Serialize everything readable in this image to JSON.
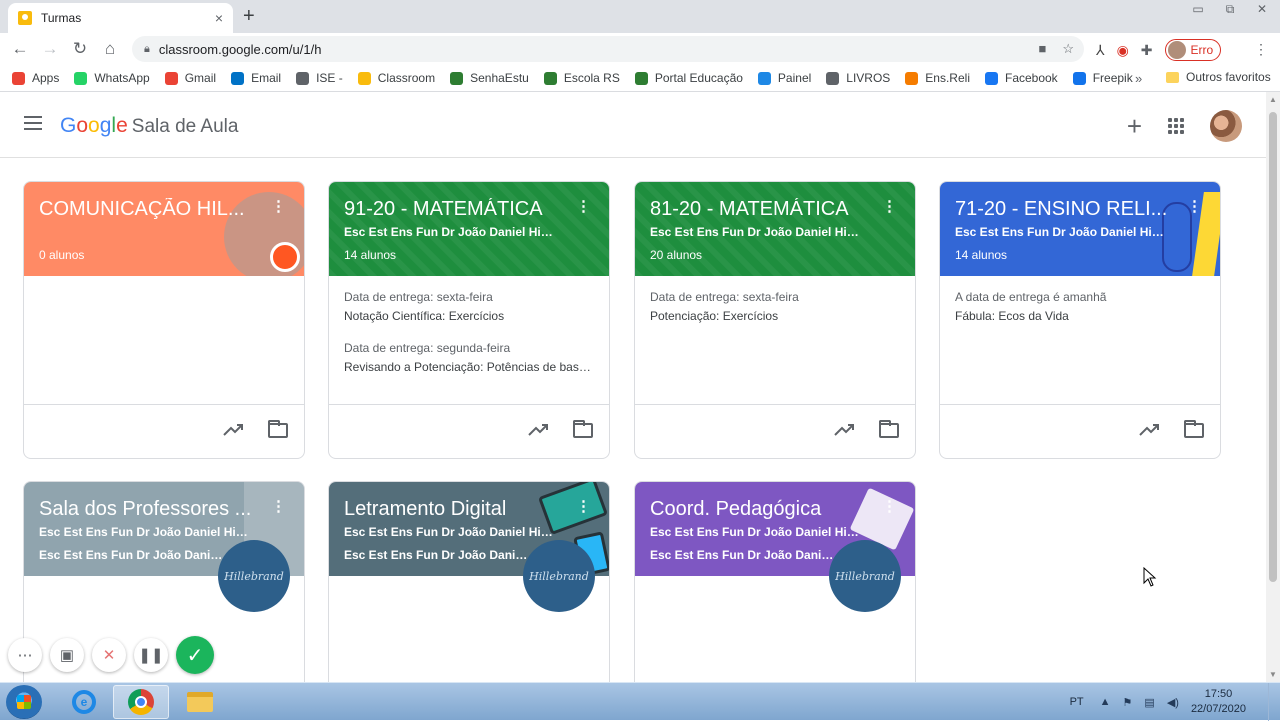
{
  "browser": {
    "tab_title": "Turmas",
    "tab_close": "×",
    "new_tab": "+",
    "url": "classroom.google.com/u/1/h",
    "profile_label": "Erro",
    "bookmarks": [
      {
        "label": "Apps",
        "icon": "apps-grid-icon",
        "color": "#ea4335"
      },
      {
        "label": "WhatsApp",
        "icon": "whatsapp-icon",
        "color": "#25d366"
      },
      {
        "label": "Gmail",
        "icon": "gmail-icon",
        "color": "#ea4335"
      },
      {
        "label": "Email",
        "icon": "outlook-icon",
        "color": "#0072c6"
      },
      {
        "label": "ISE -",
        "icon": "globe-icon",
        "color": "#5f6368"
      },
      {
        "label": "Classroom",
        "icon": "classroom-icon",
        "color": "#f9bb0d"
      },
      {
        "label": "SenhaEstu",
        "icon": "shield-icon",
        "color": "#2e7d32"
      },
      {
        "label": "Escola RS",
        "icon": "shield-icon",
        "color": "#2e7d32"
      },
      {
        "label": "Portal Educação",
        "icon": "shield-icon",
        "color": "#2e7d32"
      },
      {
        "label": "Painel",
        "icon": "share-icon",
        "color": "#1e88e5"
      },
      {
        "label": "LIVROS",
        "icon": "globe-icon",
        "color": "#5f6368"
      },
      {
        "label": "Ens.Reli",
        "icon": "blogger-icon",
        "color": "#f57c00"
      },
      {
        "label": "Facebook",
        "icon": "facebook-icon",
        "color": "#1877f2"
      },
      {
        "label": "Freepik",
        "icon": "freepik-icon",
        "color": "#1273eb"
      }
    ],
    "more_bookmarks": "»",
    "other_bookmarks": "Outros favoritos"
  },
  "app": {
    "logo_text": [
      "G",
      "o",
      "o",
      "g",
      "l",
      "e"
    ],
    "product_name": "Sala de Aula"
  },
  "cards": [
    {
      "title": "COMUNICAÇÃO HIL...",
      "section": "",
      "subsection": "",
      "count": "0 alunos",
      "color": "#ff8a65",
      "tasks": []
    },
    {
      "title": "91-20 - MATEMÁTICA",
      "section": "Esc Est Ens Fun Dr João Daniel Hilleb...",
      "subsection": "",
      "count": "14 alunos",
      "color": "#1e8e3e",
      "tasks": [
        {
          "due": "Data de entrega: sexta-feira",
          "name": "Notação Científica: Exercícios"
        },
        {
          "due": "Data de entrega: segunda-feira",
          "name": "Revisando a Potenciação: Potências de base..."
        }
      ]
    },
    {
      "title": "81-20 - MATEMÁTICA",
      "section": "Esc Est Ens Fun Dr João Daniel Hilleb...",
      "subsection": "",
      "count": "20 alunos",
      "color": "#1e8e3e",
      "tasks": [
        {
          "due": "Data de entrega: sexta-feira",
          "name": "Potenciação: Exercícios"
        }
      ]
    },
    {
      "title": "71-20 - ENSINO RELI...",
      "section": "Esc Est Ens Fun Dr João Daniel Hilleb...",
      "subsection": "",
      "count": "14 alunos",
      "color": "#3367d6",
      "tasks": [
        {
          "due": "A data de entrega é amanhã",
          "name": "Fábula: Ecos da Vida"
        }
      ]
    },
    {
      "title": "Sala dos Professores ...",
      "section": "Esc Est Ens Fun Dr João Daniel Hilleb...",
      "subsection": "Esc Est Ens Fun Dr João Daniel ...",
      "count": "",
      "color": "#90a4ae",
      "tasks": []
    },
    {
      "title": "Letramento Digital",
      "section": "Esc Est Ens Fun Dr João Daniel Hilleb...",
      "subsection": "Esc Est Ens Fun Dr João Daniel ...",
      "count": "",
      "color": "#546e7a",
      "tasks": []
    },
    {
      "title": "Coord. Pedagógica",
      "section": "Esc Est Ens Fun Dr João Daniel Hilleb...",
      "subsection": "Esc Est Ens Fun Dr João Daniel ...",
      "count": "",
      "color": "#7e57c2",
      "tasks": []
    }
  ],
  "badge_text": "Hillebrand",
  "taskbar": {
    "language": "PT",
    "time": "17:50",
    "date": "22/07/2020"
  }
}
